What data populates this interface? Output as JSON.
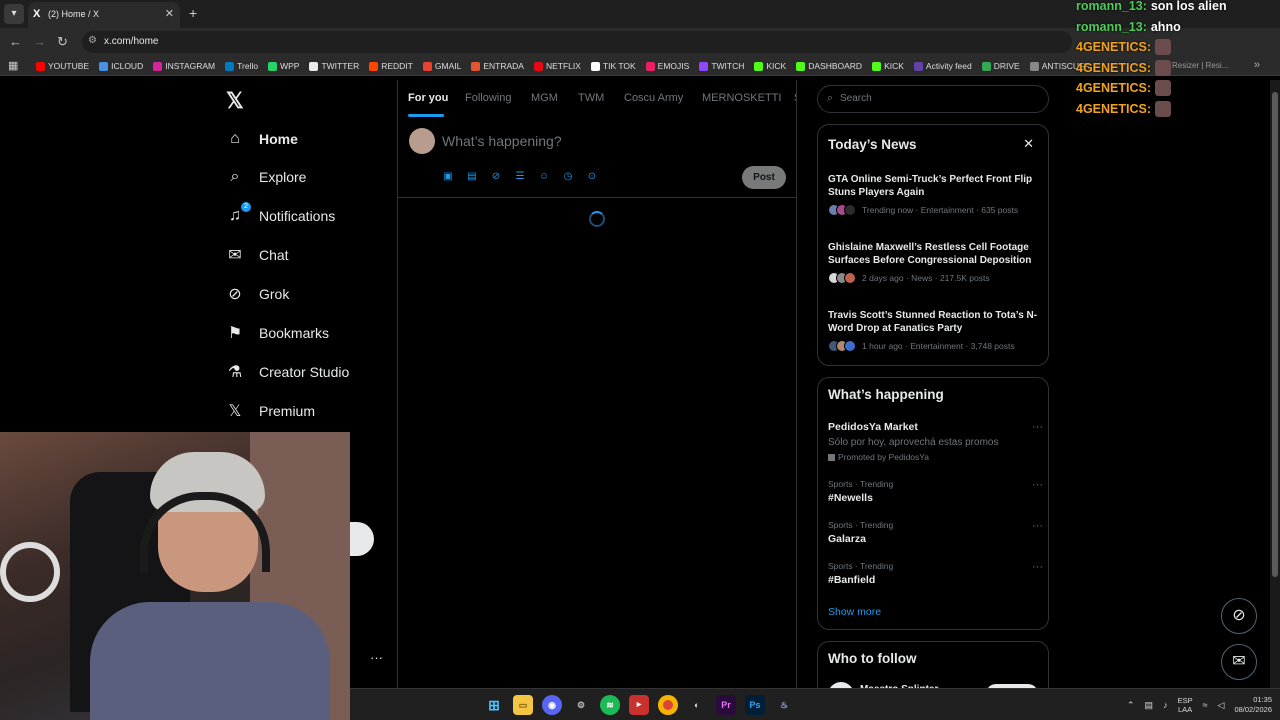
{
  "browser": {
    "tab_title": "(2) Home / X",
    "tab_favicon": "X",
    "url": "x.com/home",
    "bookmarks": [
      {
        "label": "YOUTUBE",
        "color": "#ff0000"
      },
      {
        "label": "ICLOUD",
        "color": "#4a90e2"
      },
      {
        "label": "INSTAGRAM",
        "color": "#d6249f"
      },
      {
        "label": "Trello",
        "color": "#0079bf"
      },
      {
        "label": "WPP",
        "color": "#25d366"
      },
      {
        "label": "TWITTER",
        "color": "#e7e9ea"
      },
      {
        "label": "REDDIT",
        "color": "#ff4500"
      },
      {
        "label": "GMAIL",
        "color": "#ea4335"
      },
      {
        "label": "ENTRADA",
        "color": "#e2572f"
      },
      {
        "label": "NETFLIX",
        "color": "#e50914"
      },
      {
        "label": "TIK TOK",
        "color": "#ffffff"
      },
      {
        "label": "EMOJIS",
        "color": "#e91e63"
      },
      {
        "label": "TWITCH",
        "color": "#9146ff"
      },
      {
        "label": "KICK",
        "color": "#53fc18"
      },
      {
        "label": "DASHBOARD",
        "color": "#53fc18"
      },
      {
        "label": "KICK",
        "color": "#53fc18"
      },
      {
        "label": "Activity feed",
        "color": "#6441a5"
      },
      {
        "label": "DRIVE",
        "color": "#34a853"
      },
      {
        "label": "ANTISCUFF",
        "color": "#888888"
      }
    ],
    "bookmark_extra": "Resizer | Resi..."
  },
  "stream_chat": [
    {
      "user": "romann_13:",
      "message": "son los alien",
      "user_color": "#4ecb5a",
      "emote": false
    },
    {
      "user": "romann_13:",
      "message": "ahno",
      "user_color": "#4ecb5a",
      "emote": false
    },
    {
      "user": "4GENETICS:",
      "message": "",
      "user_color": "#f2a31d",
      "emote": true
    },
    {
      "user": "4GENETICS:",
      "message": "",
      "user_color": "#f2a31d",
      "emote": true
    },
    {
      "user": "4GENETICS:",
      "message": "",
      "user_color": "#f2a31d",
      "emote": true
    },
    {
      "user": "4GENETICS:",
      "message": "",
      "user_color": "#f2a31d",
      "emote": true
    }
  ],
  "sidebar": {
    "logo": "𝕏",
    "items": [
      {
        "label": "Home",
        "icon": "home-icon",
        "glyph": "⌂",
        "active": true
      },
      {
        "label": "Explore",
        "icon": "search-icon",
        "glyph": "⌕",
        "active": false
      },
      {
        "label": "Notifications",
        "icon": "bell-icon",
        "glyph": "♫",
        "active": false,
        "badge": "2"
      },
      {
        "label": "Chat",
        "icon": "mail-icon",
        "glyph": "✉",
        "active": false
      },
      {
        "label": "Grok",
        "icon": "grok-icon",
        "glyph": "⊘",
        "active": false
      },
      {
        "label": "Bookmarks",
        "icon": "bookmark-icon",
        "glyph": "⚑",
        "active": false
      },
      {
        "label": "Creator Studio",
        "icon": "flask-icon",
        "glyph": "⚗",
        "active": false
      },
      {
        "label": "Premium",
        "icon": "x-premium-icon",
        "glyph": "𝕏",
        "active": false
      }
    ],
    "more_glyph": "···"
  },
  "feed": {
    "tabs": [
      "For you",
      "Following",
      "MGM",
      "TWM",
      "Coscu Army",
      "MERNOSKETTI",
      "S"
    ],
    "compose_placeholder": "What’s happening?",
    "post_label": "Post"
  },
  "right": {
    "search_placeholder": "Search",
    "news": {
      "title": "Today’s News",
      "items": [
        {
          "headline": "GTA Online Semi-Truck’s Perfect Front Flip Stuns Players Again",
          "meta": "Trending now · Entertainment · 635 posts"
        },
        {
          "headline": "Ghislaine Maxwell’s Restless Cell Footage Surfaces Before Congressional Deposition",
          "meta": "2 days ago · News · 217.5K posts"
        },
        {
          "headline": "Travis Scott’s Stunned Reaction to Tota’s N-Word Drop at Fanatics Party",
          "meta": "1 hour ago · Entertainment · 3,748 posts"
        }
      ]
    },
    "happening": {
      "title": "What’s happening",
      "promo": {
        "name": "PedidosYa Market",
        "sub": "Sólo por hoy, aprovechá estas promos",
        "by": "Promoted by PedidosYa"
      },
      "trends": [
        {
          "context": "Sports · Trending",
          "name": "#Newells"
        },
        {
          "context": "Sports · Trending",
          "name": "Galarza"
        },
        {
          "context": "Sports · Trending",
          "name": "#Banfield"
        }
      ],
      "show_more": "Show more"
    },
    "follow": {
      "title": "Who to follow",
      "name": "Maestro Splinter"
    }
  },
  "taskbar": {
    "lang_top": "ESP",
    "lang_bottom": "LAA",
    "time": "01:35",
    "date": "08/02/2026"
  }
}
